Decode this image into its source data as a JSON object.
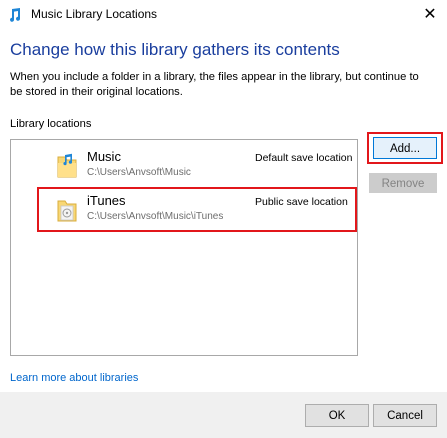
{
  "window": {
    "title": "Music Library Locations",
    "close_glyph": "✕",
    "app_icon": "music-library-icon"
  },
  "heading": "Change how this library gathers its contents",
  "description": "When you include a folder in a library, the files appear in the library, but continue to be stored in their original locations.",
  "section_label": "Library locations",
  "locations": [
    {
      "name": "Music",
      "path": "C:\\Users\\Anvsoft\\Music",
      "status": "Default save location",
      "icon": "music-folder-icon"
    },
    {
      "name": "iTunes",
      "path": "C:\\Users\\Anvsoft\\Music\\iTunes",
      "status": "Public save location",
      "icon": "itunes-folder-icon"
    }
  ],
  "buttons": {
    "add": "Add...",
    "remove": "Remove",
    "ok": "OK",
    "cancel": "Cancel"
  },
  "learn_link": "Learn more about libraries",
  "colors": {
    "heading": "#1a3e9e",
    "link": "#0066cc",
    "highlight": "#e2171b",
    "accent": "#0078d7",
    "folder": "#f8d775"
  }
}
